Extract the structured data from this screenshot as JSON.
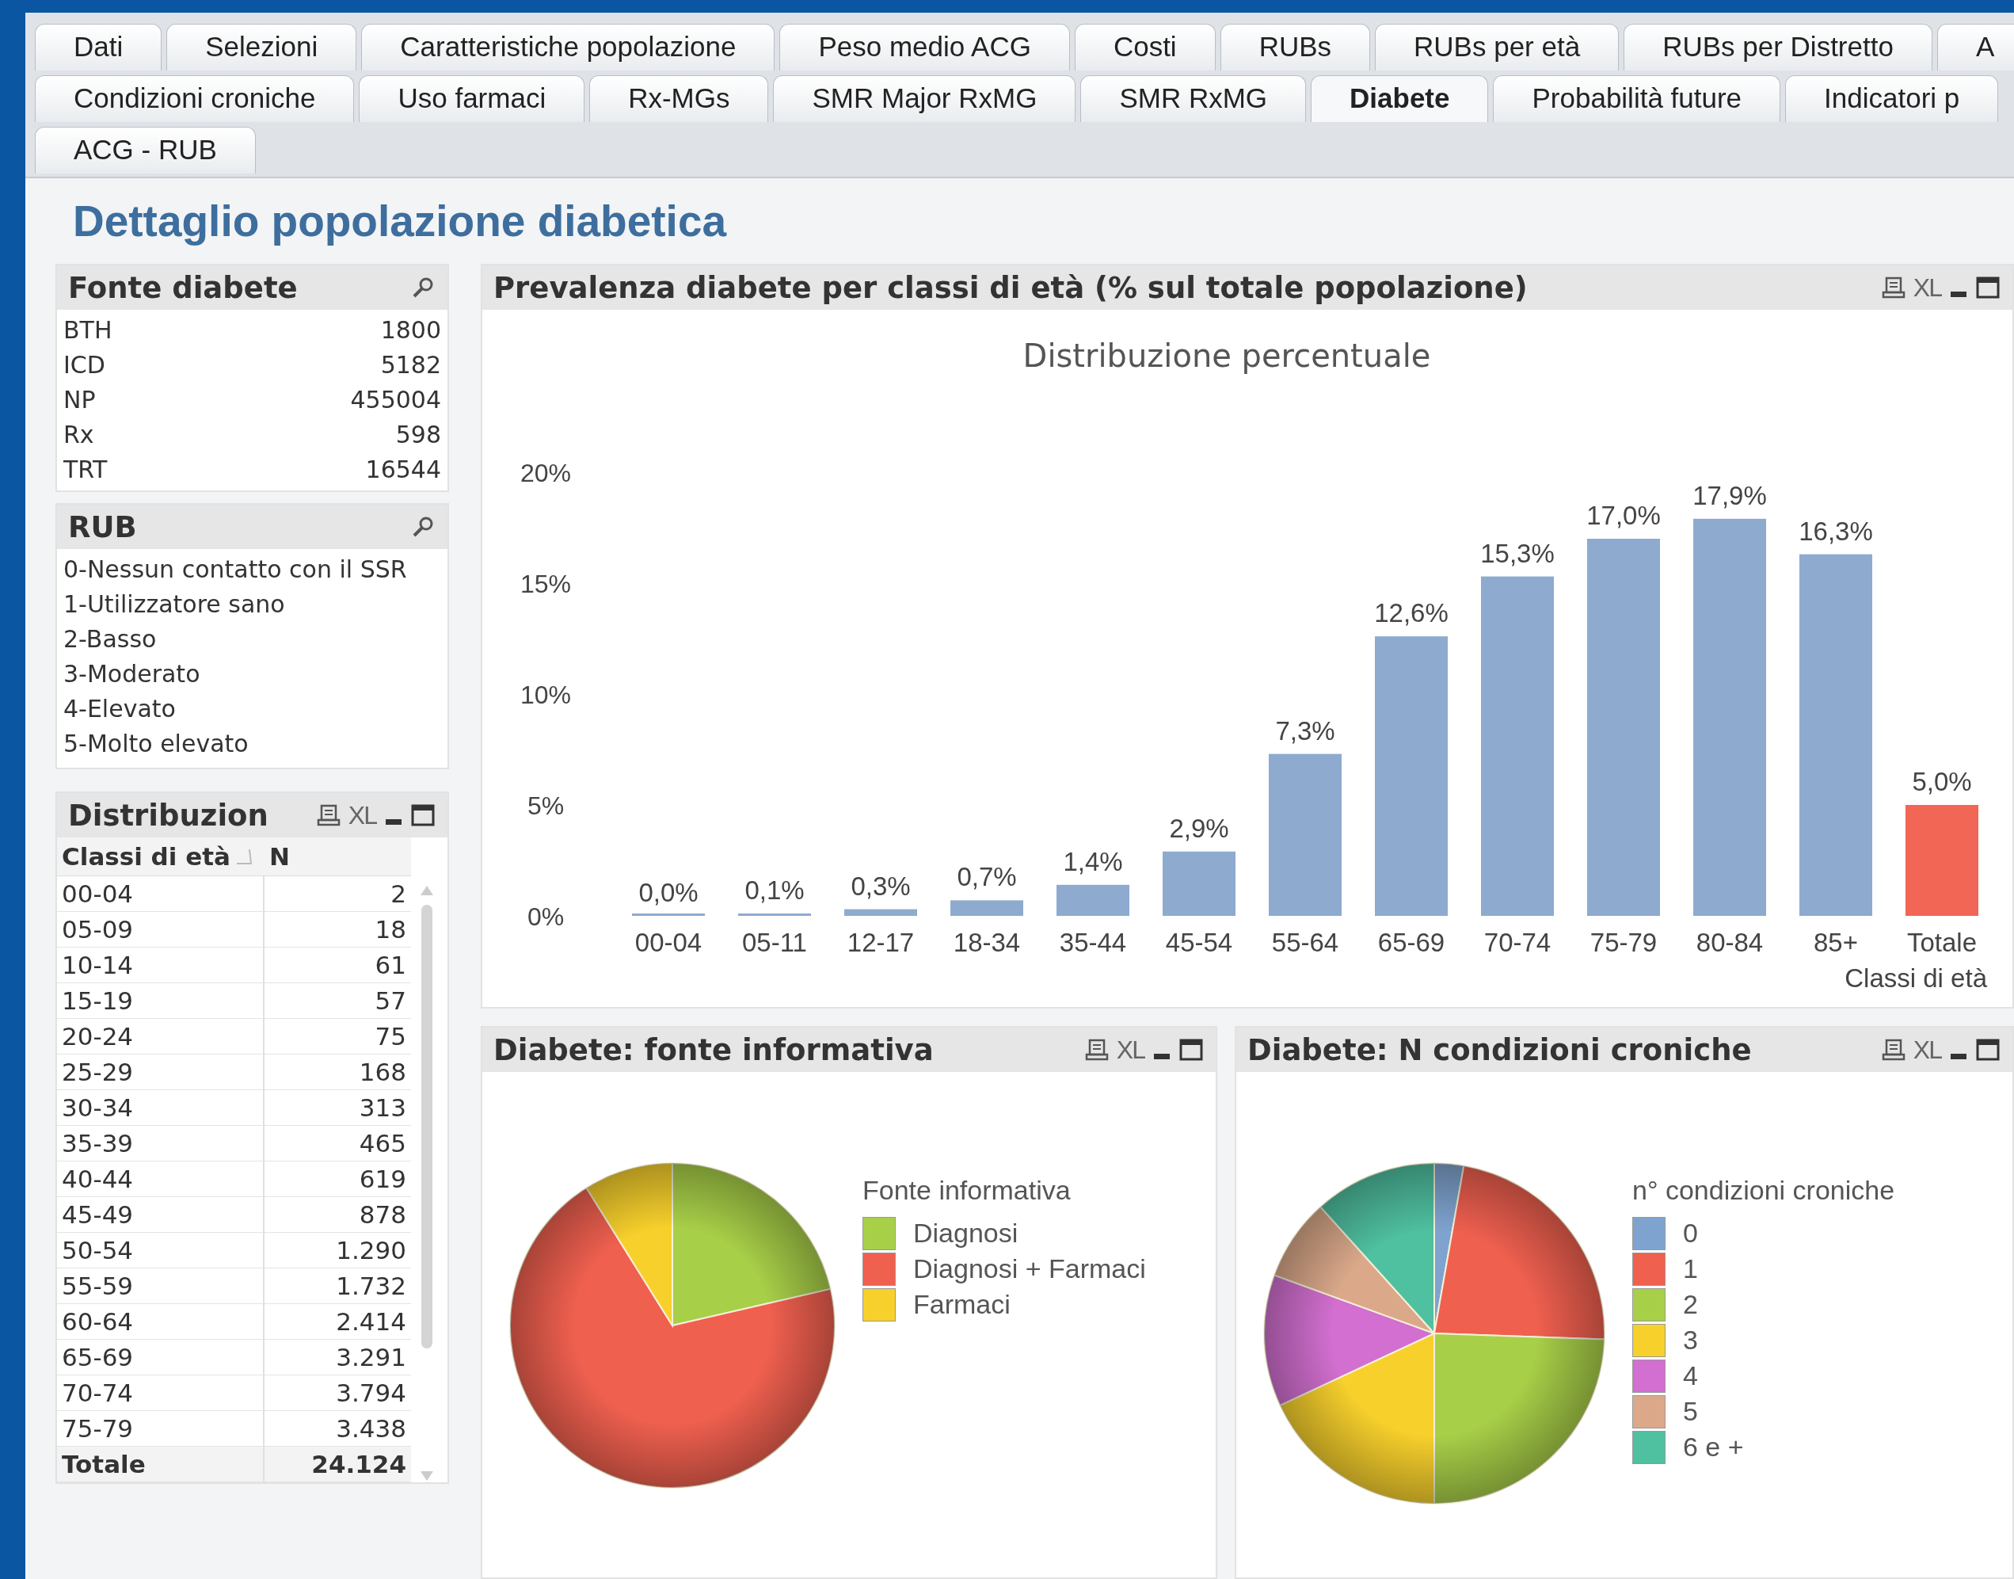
{
  "tab_rows": [
    [
      {
        "label": "Dati",
        "selected": false
      },
      {
        "label": "Selezioni",
        "selected": false
      },
      {
        "label": "Caratteristiche popolazione",
        "selected": false
      },
      {
        "label": "Peso medio ACG",
        "selected": false
      },
      {
        "label": "Costi",
        "selected": false
      },
      {
        "label": "RUBs",
        "selected": false
      },
      {
        "label": "RUBs per età",
        "selected": false
      },
      {
        "label": "RUBs per Distretto",
        "selected": false
      },
      {
        "label": "A",
        "selected": false
      }
    ],
    [
      {
        "label": "Condizioni croniche",
        "selected": false
      },
      {
        "label": "Uso farmaci",
        "selected": false
      },
      {
        "label": "Rx-MGs",
        "selected": false
      },
      {
        "label": "SMR Major RxMG",
        "selected": false
      },
      {
        "label": "SMR RxMG",
        "selected": false
      },
      {
        "label": "Diabete",
        "selected": true
      },
      {
        "label": "Probabilità future",
        "selected": false
      },
      {
        "label": "Indicatori p",
        "selected": false
      }
    ],
    [
      {
        "label": "ACG - RUB",
        "selected": false
      }
    ]
  ],
  "page_title": "Dettaglio popolazione diabetica",
  "fonte_diabete": {
    "title": "Fonte diabete",
    "items": [
      {
        "label": "BTH",
        "value": "1800"
      },
      {
        "label": "ICD",
        "value": "5182"
      },
      {
        "label": "NP",
        "value": "455004"
      },
      {
        "label": "Rx",
        "value": "598"
      },
      {
        "label": "TRT",
        "value": "16544"
      }
    ]
  },
  "rub": {
    "title": "RUB",
    "items": [
      "0-Nessun contatto con il SSR",
      "1-Utilizzatore sano",
      "2-Basso",
      "3-Moderato",
      "4-Elevato",
      "5-Molto elevato"
    ]
  },
  "distribuzione": {
    "title": "Distribuzion",
    "export_label": "XL",
    "columns": [
      "Classi di età",
      "N"
    ],
    "rows": [
      [
        "00-04",
        "2"
      ],
      [
        "05-09",
        "18"
      ],
      [
        "10-14",
        "61"
      ],
      [
        "15-19",
        "57"
      ],
      [
        "20-24",
        "75"
      ],
      [
        "25-29",
        "168"
      ],
      [
        "30-34",
        "313"
      ],
      [
        "35-39",
        "465"
      ],
      [
        "40-44",
        "619"
      ],
      [
        "45-49",
        "878"
      ],
      [
        "50-54",
        "1.290"
      ],
      [
        "55-59",
        "1.732"
      ],
      [
        "60-64",
        "2.414"
      ],
      [
        "65-69",
        "3.291"
      ],
      [
        "70-74",
        "3.794"
      ],
      [
        "75-79",
        "3.438"
      ]
    ],
    "total": [
      "Totale",
      "24.124"
    ]
  },
  "prevalenza": {
    "title": "Prevalenza diabete per classi di età (% sul totale popolazione)",
    "export_label": "XL",
    "chart_data": {
      "type": "bar",
      "title": "Distribuzione percentuale",
      "xlabel": "Classi di età",
      "categories": [
        "00-04",
        "05-11",
        "12-17",
        "18-34",
        "35-44",
        "45-54",
        "55-64",
        "65-69",
        "70-74",
        "75-79",
        "80-84",
        "85+",
        "Totale"
      ],
      "series": [
        {
          "color": "#8eaacf",
          "values": [
            0.0,
            0.1,
            0.3,
            0.7,
            1.4,
            2.9,
            7.3,
            12.6,
            15.3,
            17.0,
            17.9,
            16.3,
            null
          ]
        },
        {
          "color": "#f26656",
          "values": [
            null,
            null,
            null,
            null,
            null,
            null,
            null,
            null,
            null,
            null,
            null,
            null,
            5.0
          ]
        }
      ],
      "stacked": true,
      "ylim": [
        0,
        20
      ],
      "yticks": [
        {
          "value": 0,
          "label": "0%"
        },
        {
          "value": 5,
          "label": "5%"
        },
        {
          "value": 10,
          "label": "10%"
        },
        {
          "value": 15,
          "label": "15%"
        },
        {
          "value": 20,
          "label": "20%"
        }
      ],
      "value_labels": [
        "0,0%",
        "0,1%",
        "0,3%",
        "0,7%",
        "1,4%",
        "2,9%",
        "7,3%",
        "12,6%",
        "15,3%",
        "17,0%",
        "17,9%",
        "16,3%",
        "5,0%"
      ]
    }
  },
  "fonte_informativa": {
    "title": "Diabete: fonte informativa",
    "export_label": "XL",
    "legend_title": "Fonte informativa",
    "legend": [
      {
        "label": "Diagnosi",
        "color": "#a8cf48"
      },
      {
        "label": "Diagnosi + Farmaci",
        "color": "#f0604f"
      },
      {
        "label": "Farmaci",
        "color": "#f7d02c"
      }
    ]
  },
  "condizioni_croniche": {
    "title": "Diabete: N condizioni croniche",
    "export_label": "XL",
    "legend_title": "n° condizioni croniche",
    "legend": [
      {
        "label": "0",
        "color": "#7fa3cf"
      },
      {
        "label": "1",
        "color": "#f0604f"
      },
      {
        "label": "2",
        "color": "#a8cf48"
      },
      {
        "label": "3",
        "color": "#f7d02c"
      },
      {
        "label": "4",
        "color": "#d26fd0"
      },
      {
        "label": "5",
        "color": "#dba98a"
      },
      {
        "label": "6 e +",
        "color": "#4fc0a0"
      }
    ]
  }
}
